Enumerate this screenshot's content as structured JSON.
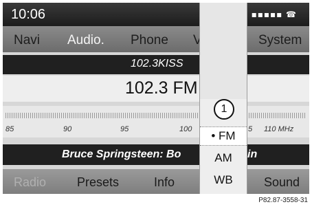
{
  "status": {
    "time": "10:06",
    "signal": "▪▪▪▪▪ ☎"
  },
  "menu": {
    "navi": "Navi",
    "audio": "Audio.",
    "phone": "Phone",
    "video": "V",
    "system": "System"
  },
  "station": {
    "name": "102.3KISS",
    "frequency": "102.3 FM"
  },
  "scale": {
    "labels": [
      "85",
      "90",
      "95",
      "100",
      "5",
      "110 MHz"
    ]
  },
  "now_playing": {
    "text": "Bruce Springsteen: Bo",
    "tail": "in"
  },
  "bottom": {
    "radio": "Radio",
    "presets": "Presets",
    "info": "Info",
    "sound": "Sound"
  },
  "band_selector": {
    "callout": "1",
    "options": [
      "• FM",
      "AM",
      "WB"
    ],
    "selected": "FM"
  },
  "caption": "P82.87-3558-31"
}
